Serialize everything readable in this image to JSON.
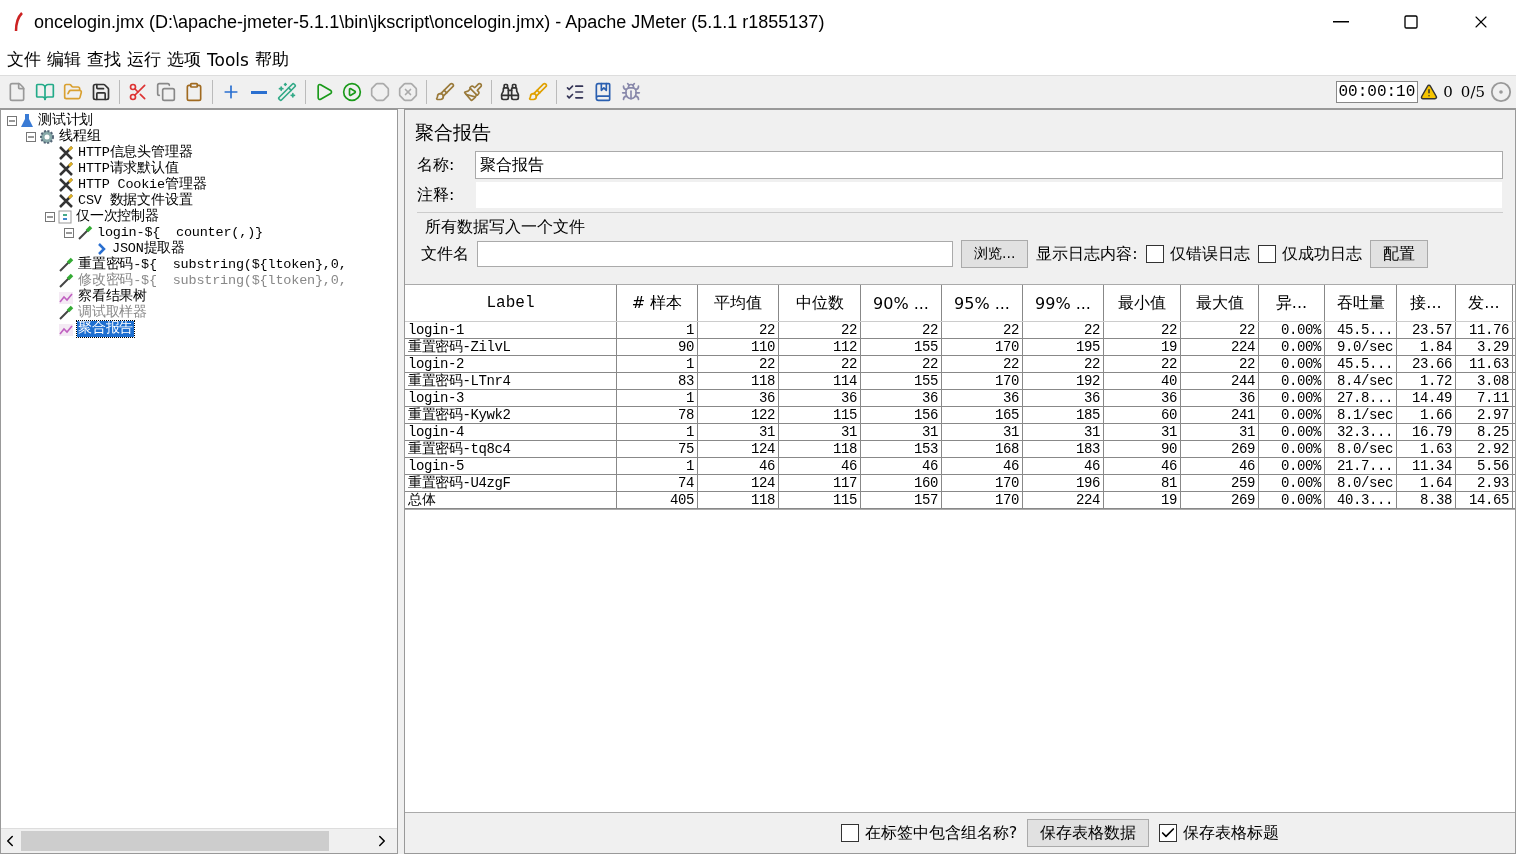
{
  "window": {
    "title": "oncelogin.jmx (D:\\apache-jmeter-5.1.1\\bin\\jkscript\\oncelogin.jmx) - Apache JMeter (5.1.1 r1855137)"
  },
  "menu": [
    "文件",
    "编辑",
    "查找",
    "运行",
    "选项",
    "Tools",
    "帮助"
  ],
  "status": {
    "timer": "00:00:10",
    "warnings": "0",
    "threads": "0/5"
  },
  "tree": {
    "label": "测试计划",
    "kind": "plan",
    "expanded": true,
    "selected": false,
    "disabled": false,
    "children": [
      {
        "label": "线程组",
        "kind": "thread",
        "expanded": true,
        "selected": false,
        "disabled": false,
        "children": [
          {
            "label": "HTTP信息头管理器",
            "kind": "config",
            "selected": false,
            "disabled": false
          },
          {
            "label": "HTTP请求默认值",
            "kind": "config",
            "selected": false,
            "disabled": false
          },
          {
            "label": "HTTP Cookie管理器",
            "kind": "config",
            "selected": false,
            "disabled": false
          },
          {
            "label": "CSV 数据文件设置",
            "kind": "config",
            "selected": false,
            "disabled": false
          },
          {
            "label": "仅一次控制器",
            "kind": "controller",
            "expanded": true,
            "selected": false,
            "disabled": false,
            "children": [
              {
                "label": "login-${  counter(,)}",
                "kind": "sampler",
                "expanded": true,
                "selected": false,
                "disabled": false,
                "children": [
                  {
                    "label": "JSON提取器",
                    "kind": "extractor",
                    "selected": false,
                    "disabled": false
                  }
                ]
              }
            ]
          },
          {
            "label": "重置密码-${  substring(${ltoken},0,",
            "kind": "sampler",
            "selected": false,
            "disabled": false
          },
          {
            "label": "修改密码-${  substring(${ltoken},0,",
            "kind": "sampler",
            "selected": false,
            "disabled": true
          },
          {
            "label": "察看结果树",
            "kind": "listener",
            "selected": false,
            "disabled": false
          },
          {
            "label": "调试取样器",
            "kind": "sampler",
            "selected": false,
            "disabled": true
          },
          {
            "label": "聚合报告",
            "kind": "listener",
            "selected": true,
            "disabled": false
          }
        ]
      }
    ]
  },
  "panel": {
    "title": "聚合报告",
    "name_label": "名称:",
    "name_value": "聚合报告",
    "comment_label": "注释:",
    "file_group": {
      "title": "所有数据写入一个文件",
      "file_label": "文件名",
      "browse": "浏览...",
      "log_label": "显示日志内容:",
      "errors_only": {
        "label": "仅错误日志",
        "checked": false
      },
      "success_only": {
        "label": "仅成功日志",
        "checked": false
      },
      "configure": "配置"
    }
  },
  "table": {
    "columns": [
      "Label",
      "# 样本",
      "平均值",
      "中位数",
      "90% ...",
      "95% ...",
      "99% ...",
      "最小值",
      "最大值",
      "异...",
      "吞吐量",
      "接...",
      "发..."
    ],
    "rows": [
      [
        "login-1",
        "1",
        "22",
        "22",
        "22",
        "22",
        "22",
        "22",
        "22",
        "0.00%",
        "45.5...",
        "23.57",
        "11.76"
      ],
      [
        "重置密码-ZilvL",
        "90",
        "110",
        "112",
        "155",
        "170",
        "195",
        "19",
        "224",
        "0.00%",
        "9.0/sec",
        "1.84",
        "3.29"
      ],
      [
        "login-2",
        "1",
        "22",
        "22",
        "22",
        "22",
        "22",
        "22",
        "22",
        "0.00%",
        "45.5...",
        "23.66",
        "11.63"
      ],
      [
        "重置密码-LTnr4",
        "83",
        "118",
        "114",
        "155",
        "170",
        "192",
        "40",
        "244",
        "0.00%",
        "8.4/sec",
        "1.72",
        "3.08"
      ],
      [
        "login-3",
        "1",
        "36",
        "36",
        "36",
        "36",
        "36",
        "36",
        "36",
        "0.00%",
        "27.8...",
        "14.49",
        "7.11"
      ],
      [
        "重置密码-Kywk2",
        "78",
        "122",
        "115",
        "156",
        "165",
        "185",
        "60",
        "241",
        "0.00%",
        "8.1/sec",
        "1.66",
        "2.97"
      ],
      [
        "login-4",
        "1",
        "31",
        "31",
        "31",
        "31",
        "31",
        "31",
        "31",
        "0.00%",
        "32.3...",
        "16.79",
        "8.25"
      ],
      [
        "重置密码-tq8c4",
        "75",
        "124",
        "118",
        "153",
        "168",
        "183",
        "90",
        "269",
        "0.00%",
        "8.0/sec",
        "1.63",
        "2.92"
      ],
      [
        "login-5",
        "1",
        "46",
        "46",
        "46",
        "46",
        "46",
        "46",
        "46",
        "0.00%",
        "21.7...",
        "11.34",
        "5.56"
      ],
      [
        "重置密码-U4zgF",
        "74",
        "124",
        "117",
        "160",
        "170",
        "196",
        "81",
        "259",
        "0.00%",
        "8.0/sec",
        "1.64",
        "2.93"
      ],
      [
        "总体",
        "405",
        "118",
        "115",
        "157",
        "170",
        "224",
        "19",
        "269",
        "0.00%",
        "40.3...",
        "8.38",
        "14.65"
      ]
    ]
  },
  "footer": {
    "include_group": {
      "label": "在标签中包含组名称?",
      "checked": false
    },
    "save_data": "保存表格数据",
    "save_header": {
      "label": "保存表格标题",
      "checked": true
    }
  }
}
